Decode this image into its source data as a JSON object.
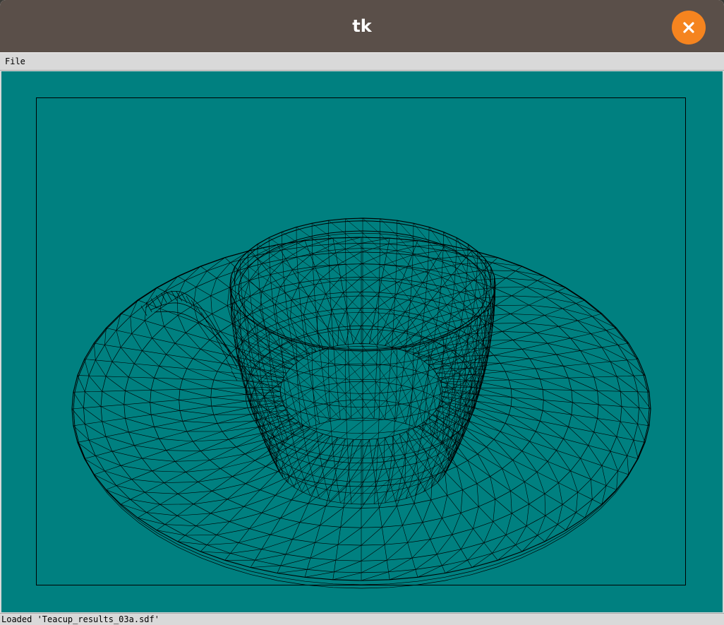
{
  "window": {
    "title": "tk"
  },
  "menubar": {
    "items": [
      {
        "label": "File"
      }
    ]
  },
  "viewport": {
    "background_color": "#008080",
    "line_color": "#000000",
    "content": "wireframe-teacup-and-saucer"
  },
  "status": {
    "text": "Loaded 'Teacup_results_03a.sdf'"
  },
  "colors": {
    "titlebar": "#5a4f49",
    "close_button": "#f5841f",
    "chrome": "#d9d9d9"
  }
}
